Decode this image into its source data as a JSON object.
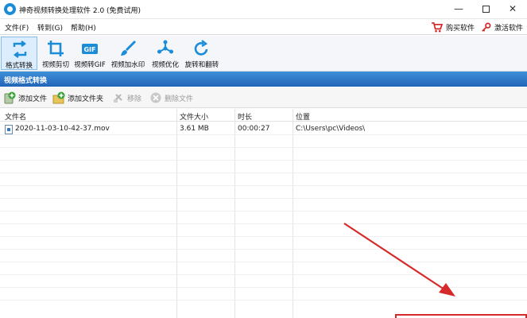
{
  "window": {
    "title": "神奇视频转换处理软件 2.0 (免费试用)",
    "minimize": "—",
    "close": "✕"
  },
  "menu": {
    "items": [
      "文件(F)",
      "转到(G)",
      "帮助(H)"
    ],
    "buy": "购买软件",
    "activate": "激活软件"
  },
  "toolbar": {
    "tools": [
      {
        "label": "格式转换",
        "icon": "format-convert-icon",
        "active": true
      },
      {
        "label": "视频剪切",
        "icon": "crop-icon"
      },
      {
        "label": "视频转GIF",
        "icon": "gif-icon"
      },
      {
        "label": "视频加水印",
        "icon": "watermark-brush-icon"
      },
      {
        "label": "视频优化",
        "icon": "optimize-icon"
      },
      {
        "label": "旋转和翻转",
        "icon": "rotate-icon"
      }
    ]
  },
  "section": {
    "title": "视频格式转换"
  },
  "actions": {
    "add_file": "添加文件",
    "add_folder": "添加文件夹",
    "remove": "移除",
    "delete_file": "删除文件"
  },
  "table": {
    "columns": [
      "文件名",
      "文件大小",
      "时长",
      "位置"
    ],
    "rows": [
      {
        "name": "2020-11-03-10-42-37.mov",
        "size": "3.61 MB",
        "duration": "00:00:27",
        "location": "C:\\Users\\pc\\Videos\\"
      }
    ]
  },
  "colors": {
    "accent": "#1a8cd8",
    "header_bar": "#2b6fc2",
    "annotation_red": "#d62a2a"
  }
}
